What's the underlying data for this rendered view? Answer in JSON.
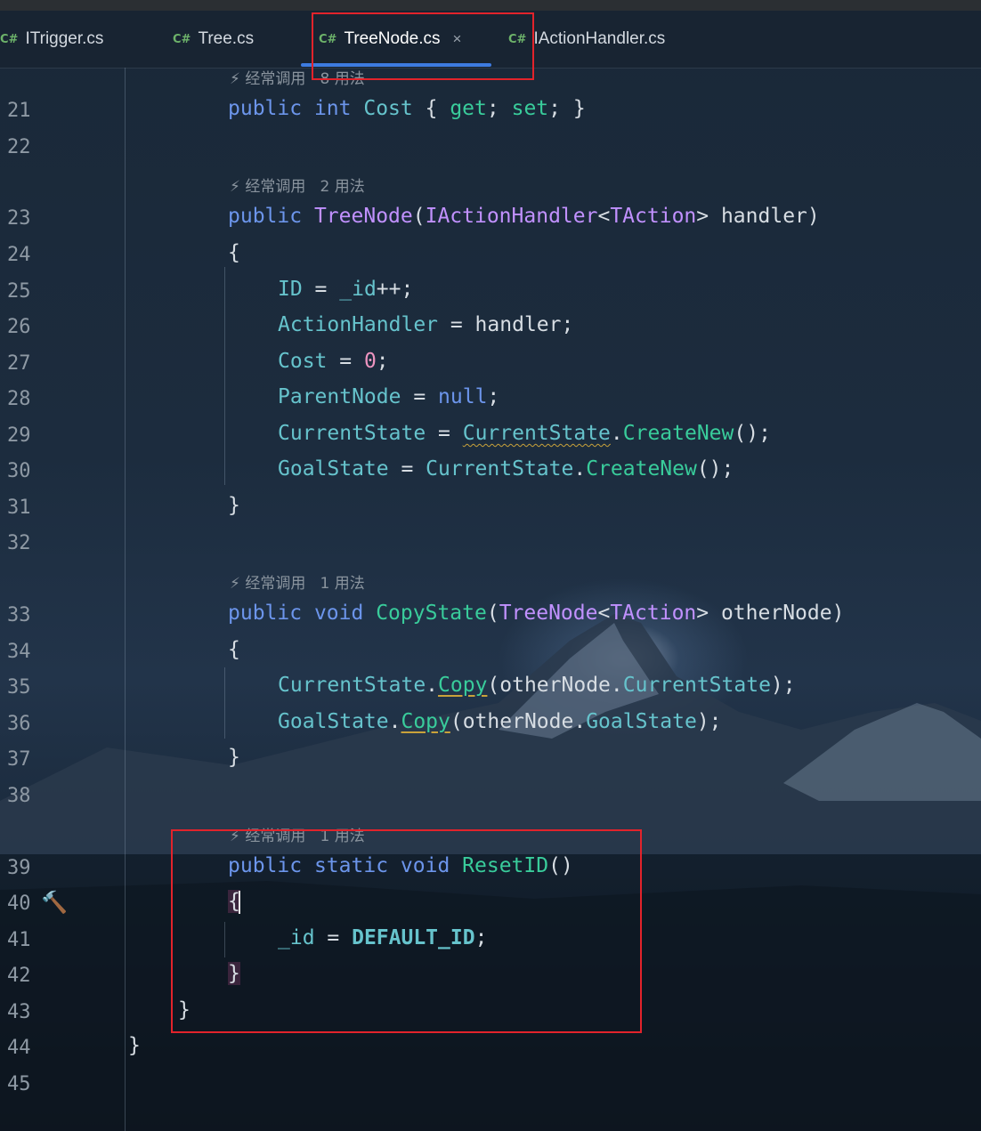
{
  "tabs": [
    {
      "lang": "C#",
      "label": "ITrigger.cs"
    },
    {
      "lang": "C#",
      "label": "Tree.cs"
    },
    {
      "lang": "C#",
      "label": "TreeNode.cs",
      "active": true,
      "close": "×"
    },
    {
      "lang": "C#",
      "label": "IActionHandler.cs"
    }
  ],
  "hints": {
    "h1": "经常调用   8 用法",
    "h2": "经常调用   2 用法",
    "h3": "经常调用   1 用法",
    "h4": "经常调用   1 用法"
  },
  "line_numbers": [
    "21",
    "22",
    "23",
    "24",
    "25",
    "26",
    "27",
    "28",
    "29",
    "30",
    "31",
    "32",
    "33",
    "34",
    "35",
    "36",
    "37",
    "38",
    "39",
    "40",
    "41",
    "42",
    "43",
    "44",
    "45"
  ],
  "code": {
    "l21": [
      "public",
      "int",
      "Cost",
      "{",
      "get",
      ";",
      "set",
      "; }"
    ],
    "l23": [
      "public",
      "TreeNode",
      "(",
      "IActionHandler",
      "<",
      "TAction",
      "> handler)"
    ],
    "l24": "{",
    "l25": [
      "ID",
      " = ",
      "_id",
      "++;"
    ],
    "l26": [
      "ActionHandler",
      " = handler;"
    ],
    "l27": [
      "Cost",
      " = ",
      "0",
      ";"
    ],
    "l28": [
      "ParentNode",
      " = ",
      "null",
      ";"
    ],
    "l29": [
      "CurrentState",
      " = ",
      "CurrentState",
      ".",
      "CreateNew",
      "();"
    ],
    "l30": [
      "GoalState",
      " = ",
      "CurrentState",
      ".",
      "CreateNew",
      "();"
    ],
    "l31": "}",
    "l33": [
      "public",
      "void",
      "CopyState",
      "(",
      "TreeNode",
      "<",
      "TAction",
      "> otherNode)"
    ],
    "l34": "{",
    "l35": [
      "CurrentState",
      ".",
      "Copy",
      "(otherNode.",
      "CurrentState",
      ");"
    ],
    "l36": [
      "GoalState",
      ".",
      "Copy",
      "(otherNode.",
      "GoalState",
      ");"
    ],
    "l37": "}",
    "l39": [
      "public",
      "static",
      "void",
      "ResetID",
      "()"
    ],
    "l40": "{",
    "l41": [
      "_id",
      " = ",
      "DEFAULT_ID",
      ";"
    ],
    "l42": "}",
    "l43": "}",
    "l44": "}"
  },
  "icons": {
    "hint_fire": "fire-icon",
    "hint_usage": "usage-link-icon",
    "gutter": "hammer-icon"
  },
  "colors": {
    "keyword": "#6c95eb",
    "type": "#c191ff",
    "method": "#39cc9b",
    "property": "#66c3cc",
    "number": "#ed94c0",
    "highlight_box": "#e2232b",
    "tab_underline": "#3d7be0"
  }
}
